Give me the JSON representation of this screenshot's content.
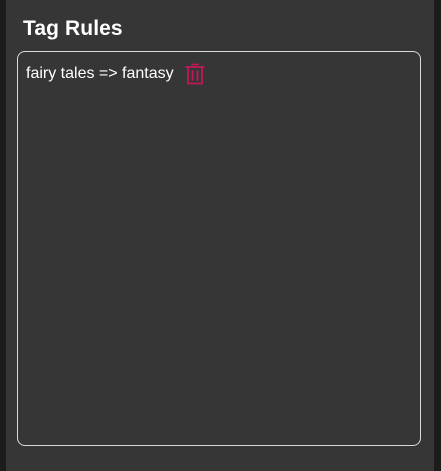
{
  "section": {
    "title": "Tag Rules"
  },
  "rules": [
    {
      "text": "fairy tales => fantasy",
      "delete_icon": "trash-icon"
    }
  ],
  "colors": {
    "background": "#1c1c1c",
    "panel": "#363636",
    "text": "#ffffff",
    "border": "#d9d9d9",
    "delete_accent": "#c2185b"
  }
}
